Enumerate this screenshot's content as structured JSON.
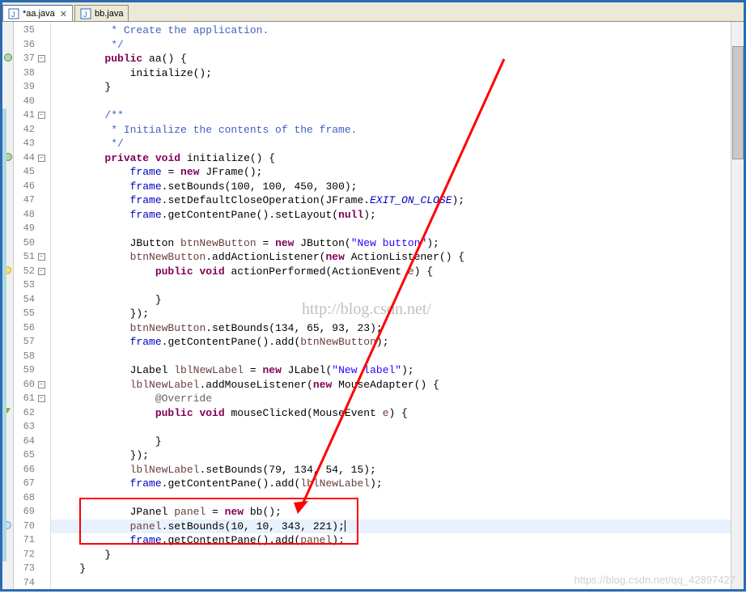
{
  "tabs": [
    {
      "label": "*aa.java",
      "icon": "J",
      "active": true
    },
    {
      "label": "bb.java",
      "icon": "J",
      "active": false
    }
  ],
  "watermark": "http://blog.csdn.net/",
  "bottom_watermark": "https://blog.csdn.net/qq_42897427",
  "lines": [
    {
      "n": 35,
      "fold": "",
      "marker": "",
      "html": "         * Create the application.",
      "cls": "com"
    },
    {
      "n": 36,
      "fold": "",
      "marker": "",
      "html": "         */",
      "cls": "com"
    },
    {
      "n": 37,
      "fold": "-",
      "marker": "method",
      "html": "        <span class='kw'>public</span> aa() {"
    },
    {
      "n": 38,
      "fold": "",
      "marker": "",
      "html": "            initialize();"
    },
    {
      "n": 39,
      "fold": "",
      "marker": "",
      "html": "        }"
    },
    {
      "n": 40,
      "fold": "",
      "marker": "",
      "html": ""
    },
    {
      "n": 41,
      "fold": "-",
      "marker": "",
      "html": "        /**",
      "cls": "com",
      "bluestrip": true
    },
    {
      "n": 42,
      "fold": "",
      "marker": "",
      "html": "         * Initialize the contents of the frame.",
      "cls": "com",
      "bluestrip": true
    },
    {
      "n": 43,
      "fold": "",
      "marker": "",
      "html": "         */",
      "cls": "com",
      "bluestrip": true
    },
    {
      "n": 44,
      "fold": "-",
      "marker": "method",
      "html": "        <span class='kw'>private</span> <span class='kw'>void</span> initialize() {",
      "bluestrip": true
    },
    {
      "n": 45,
      "fold": "",
      "marker": "",
      "html": "            <span class='field'>frame</span> = <span class='kw'>new</span> JFrame();",
      "bluestrip": true
    },
    {
      "n": 46,
      "fold": "",
      "marker": "",
      "html": "            <span class='field'>frame</span>.setBounds(100, 100, 450, 300);",
      "bluestrip": true
    },
    {
      "n": 47,
      "fold": "",
      "marker": "",
      "html": "            <span class='field'>frame</span>.setDefaultCloseOperation(JFrame.<span class='static-field'>EXIT_ON_CLOSE</span>);",
      "bluestrip": true
    },
    {
      "n": 48,
      "fold": "",
      "marker": "",
      "html": "            <span class='field'>frame</span>.getContentPane().setLayout(<span class='kw'>null</span>);",
      "bluestrip": true
    },
    {
      "n": 49,
      "fold": "",
      "marker": "",
      "html": "",
      "bluestrip": true
    },
    {
      "n": 50,
      "fold": "",
      "marker": "",
      "html": "            JButton <span class='id'>btnNewButton</span> = <span class='kw'>new</span> JButton(<span class='str'>\"New button\"</span>);",
      "bluestrip": true
    },
    {
      "n": 51,
      "fold": "-",
      "marker": "",
      "html": "            <span class='id'>btnNewButton</span>.addActionListener(<span class='kw'>new</span> ActionListener() {",
      "bluestrip": true
    },
    {
      "n": 52,
      "fold": "-",
      "marker": "warning",
      "html": "                <span class='kw'>public</span> <span class='kw'>void</span> actionPerformed(ActionEvent <span class='id'>e</span>) {",
      "bluestrip": true
    },
    {
      "n": 53,
      "fold": "",
      "marker": "",
      "html": "",
      "bluestrip": true
    },
    {
      "n": 54,
      "fold": "",
      "marker": "",
      "html": "                }",
      "bluestrip": true
    },
    {
      "n": 55,
      "fold": "",
      "marker": "",
      "html": "            });",
      "bluestrip": true
    },
    {
      "n": 56,
      "fold": "",
      "marker": "",
      "html": "            <span class='id'>btnNewButton</span>.setBounds(134, 65, 93, 23);",
      "bluestrip": true
    },
    {
      "n": 57,
      "fold": "",
      "marker": "",
      "html": "            <span class='field'>frame</span>.getContentPane().add(<span class='id'>btnNewButton</span>);",
      "bluestrip": true
    },
    {
      "n": 58,
      "fold": "",
      "marker": "",
      "html": "",
      "bluestrip": true
    },
    {
      "n": 59,
      "fold": "",
      "marker": "",
      "html": "            JLabel <span class='id'>lblNewLabel</span> = <span class='kw'>new</span> JLabel(<span class='str'>\"New label\"</span>);",
      "bluestrip": true
    },
    {
      "n": 60,
      "fold": "-",
      "marker": "",
      "html": "            <span class='id'>lblNewLabel</span>.addMouseListener(<span class='kw'>new</span> MouseAdapter() {",
      "bluestrip": true
    },
    {
      "n": 61,
      "fold": "-",
      "marker": "",
      "html": "                <span class='ann'>@Override</span>",
      "bluestrip": true
    },
    {
      "n": 62,
      "fold": "",
      "marker": "override",
      "html": "                <span class='kw'>public</span> <span class='kw'>void</span> mouseClicked(MouseEvent <span class='id'>e</span>) {",
      "bluestrip": true
    },
    {
      "n": 63,
      "fold": "",
      "marker": "",
      "html": "",
      "bluestrip": true
    },
    {
      "n": 64,
      "fold": "",
      "marker": "",
      "html": "                }",
      "bluestrip": true
    },
    {
      "n": 65,
      "fold": "",
      "marker": "",
      "html": "            });",
      "bluestrip": true
    },
    {
      "n": 66,
      "fold": "",
      "marker": "",
      "html": "            <span class='id'>lblNewLabel</span>.setBounds(79, 134, 54, 15);",
      "bluestrip": true
    },
    {
      "n": 67,
      "fold": "",
      "marker": "",
      "html": "            <span class='field'>frame</span>.getContentPane().add(<span class='id'>lblNewLabel</span>);",
      "bluestrip": true
    },
    {
      "n": 68,
      "fold": "",
      "marker": "",
      "html": "",
      "bluestrip": true
    },
    {
      "n": 69,
      "fold": "",
      "marker": "",
      "html": "            JPanel <span class='id'>panel</span> = <span class='kw'>new</span> bb();",
      "bluestrip": true
    },
    {
      "n": 70,
      "fold": "",
      "marker": "task",
      "html": "            <span class='id'>panel</span>.setBounds(10, 10, 343, 221);<span class='cursor'></span>",
      "bluestrip": true,
      "highlight": true
    },
    {
      "n": 71,
      "fold": "",
      "marker": "",
      "html": "            <span class='field'>frame</span>.getContentPane().add(<span class='id'>panel</span>);",
      "bluestrip": true
    },
    {
      "n": 72,
      "fold": "",
      "marker": "",
      "html": "        }",
      "bluestrip": true
    },
    {
      "n": 73,
      "fold": "",
      "marker": "",
      "html": "    }"
    },
    {
      "n": 74,
      "fold": "",
      "marker": "",
      "html": ""
    }
  ]
}
